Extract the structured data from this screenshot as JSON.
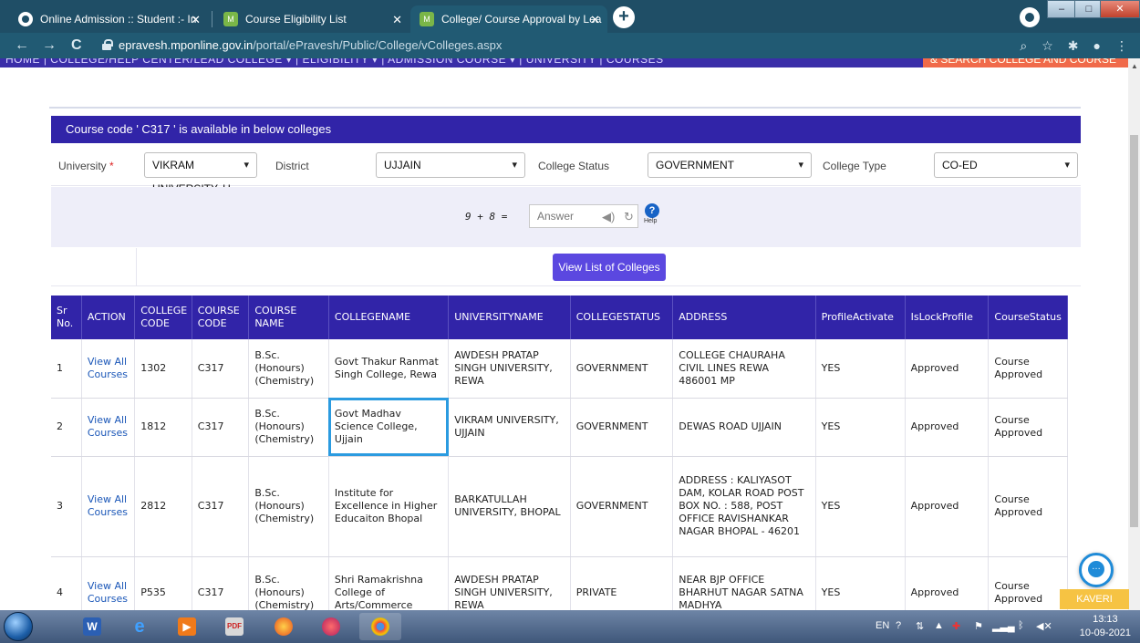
{
  "browser": {
    "tabs": [
      {
        "title": "Online Admission :: Student :- In",
        "icon": "chrome-icon"
      },
      {
        "title": "Course Eligibility List",
        "icon": "mponline-icon"
      },
      {
        "title": "College/ Course Approval by Lea",
        "icon": "mponline-icon",
        "active": true
      }
    ],
    "url_host": "epravesh.mponline.gov.in",
    "url_path": "/portal/ePravesh/Public/College/vColleges.aspx"
  },
  "site_nav": {
    "items_text": "HOME  |  COLLEGE/HELP CENTER/LEAD COLLEGE  ▾  |  ELIGIBILITY  ▾  |  ADMISSION COURSE  ▾  |  UNIVERSITY  |  COURSES",
    "search_label": "& SEARCH COLLEGE AND COURSE"
  },
  "panel": {
    "title": "Course code ' C317 ' is available in below colleges"
  },
  "filters": {
    "university_label": "University",
    "university_required": "*",
    "university_value": "VIKRAM UNIVERSITY, U",
    "district_label": "District",
    "district_value": "UJJAIN",
    "college_status_label": "College Status",
    "college_status_value": "GOVERNMENT",
    "college_type_label": "College Type",
    "college_type_value": "CO-ED"
  },
  "captcha": {
    "question": "9 + 8 =",
    "answer_placeholder": "Answer",
    "help_label": "Help"
  },
  "view_button_label": "View List of Colleges",
  "table": {
    "headers": [
      "Sr No.",
      "ACTION",
      "COLLEGE CODE",
      "COURSE CODE",
      "COURSE NAME",
      "COLLEGENAME",
      "UNIVERSITYNAME",
      "COLLEGESTATUS",
      "ADDRESS",
      "ProfileActivate",
      "IsLockProfile",
      "CourseStatus"
    ],
    "rows": [
      {
        "sr": "1",
        "action": "View All Courses",
        "college_code": "1302",
        "course_code": "C317",
        "course_name": "B.Sc. (Honours) (Chemistry)",
        "college_name": "Govt Thakur Ranmat Singh College, Rewa",
        "university": "AWDESH PRATAP SINGH UNIVERSITY, REWA",
        "status": "GOVERNMENT",
        "address": "COLLEGE CHAURAHA CIVIL LINES REWA 486001 MP",
        "profile_activate": "YES",
        "lock_profile": "Approved",
        "course_status": "Course Approved"
      },
      {
        "sr": "2",
        "action": "View All Courses",
        "college_code": "1812",
        "course_code": "C317",
        "course_name": "B.Sc. (Honours) (Chemistry)",
        "college_name": "Govt Madhav Science College, Ujjain",
        "university": "VIKRAM UNIVERSITY, UJJAIN",
        "status": "GOVERNMENT",
        "address": "DEWAS ROAD UJJAIN",
        "profile_activate": "YES",
        "lock_profile": "Approved",
        "course_status": "Course Approved"
      },
      {
        "sr": "3",
        "action": "View All Courses",
        "college_code": "2812",
        "course_code": "C317",
        "course_name": "B.Sc. (Honours) (Chemistry)",
        "college_name": "Institute for Excellence in Higher Educaiton Bhopal",
        "university": "BARKATULLAH UNIVERSITY, BHOPAL",
        "status": "GOVERNMENT",
        "address": "ADDRESS : KALIYASOT DAM, KOLAR ROAD POST BOX NO. : 588, POST OFFICE RAVISHANKAR NAGAR BHOPAL - 46201",
        "profile_activate": "YES",
        "lock_profile": "Approved",
        "course_status": "Course Approved"
      },
      {
        "sr": "4",
        "action": "View All Courses",
        "college_code": "P535",
        "course_code": "C317",
        "course_name": "B.Sc. (Honours) (Chemistry)",
        "college_name": "Shri Ramakrishna College of Arts/Commerce",
        "university": "AWDESH PRATAP SINGH UNIVERSITY, REWA",
        "status": "PRIVATE",
        "address": "NEAR BJP OFFICE BHARHUT NAGAR SATNA MADHYA",
        "profile_activate": "YES",
        "lock_profile": "Approved",
        "course_status": "Course Approved"
      }
    ]
  },
  "chat_widget_label": "KAVERI",
  "taskbar": {
    "language": "EN",
    "time": "13:13",
    "date": "10-09-2021"
  },
  "colors": {
    "header_blue": "#3124a8",
    "button_purple": "#5b48e0",
    "highlight_outline": "#2b9be0",
    "nav_orange": "#f06a4a"
  }
}
